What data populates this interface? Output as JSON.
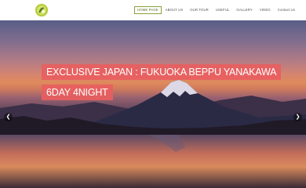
{
  "nav": {
    "items": [
      {
        "label": "HOME PAGE",
        "active": true
      },
      {
        "label": "ABOUT US"
      },
      {
        "label": "OUR TOUR"
      },
      {
        "label": "USEFUL"
      },
      {
        "label": "GALLERY"
      },
      {
        "label": "VIDEO"
      },
      {
        "label": "Contact Us"
      }
    ]
  },
  "hero": {
    "title_line1": "EXCLUSIVE JAPAN : FUKUOKA BEPPU YANAKAWA",
    "title_line2": "6DAY 4NIGHT"
  },
  "slider": {
    "prev_icon": "chevron-left-icon",
    "next_icon": "chevron-right-icon"
  },
  "colors": {
    "accent": "#e85e60",
    "nav_active_border": "#8aa23a"
  }
}
